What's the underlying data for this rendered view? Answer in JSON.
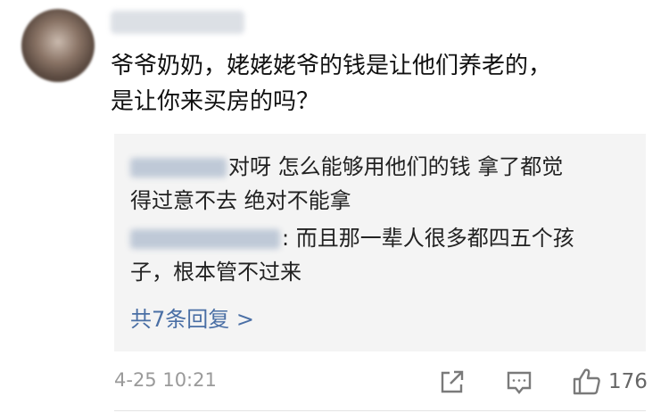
{
  "comment": {
    "text_line1": "爷爷奶奶，姥姥姥爷的钱是让他们养老的，",
    "text_line2": "是让你来买房的吗？"
  },
  "replies": [
    {
      "text_line1": "对呀 怎么能够用他们的钱  拿了都觉",
      "text_line2": "得过意不去 绝对不能拿"
    },
    {
      "text_line1": ": 而且那一辈人很多都四五个孩",
      "text_line2": "子，根本管不过来"
    }
  ],
  "more_replies_label": "共7条回复 >",
  "timestamp": "4-25 10:21",
  "likes": "176",
  "icons": {
    "share": "share-icon",
    "reply": "comment-icon",
    "like": "thumbs-up-icon"
  }
}
